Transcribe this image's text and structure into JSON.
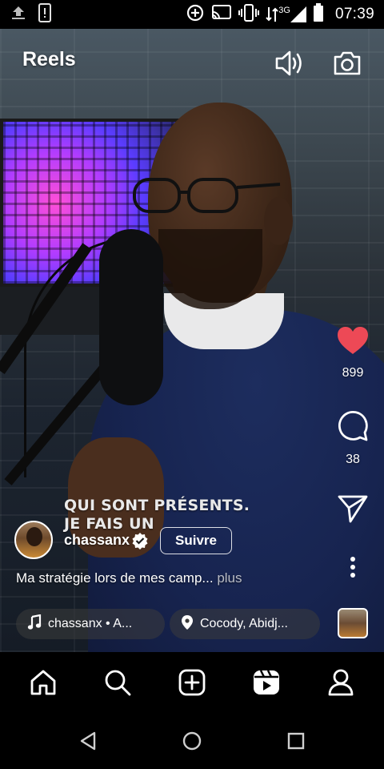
{
  "status_bar": {
    "time": "07:39",
    "network": "3G",
    "icons": [
      "upload-icon",
      "phone-icon",
      "data-saver-icon",
      "cast-icon",
      "vibrate-icon",
      "signal-icon",
      "battery-icon"
    ]
  },
  "header": {
    "title": "Reels",
    "icons": [
      "volume-icon",
      "camera-icon"
    ]
  },
  "video": {
    "caption_lines": [
      "QUI SONT PRÉSENTS.",
      "JE FAIS UN"
    ]
  },
  "actions": {
    "likes": "899",
    "comments": "38",
    "icons": [
      "heart-icon",
      "comment-icon",
      "share-icon",
      "more-icon"
    ],
    "heart_color": "#ED4956"
  },
  "author": {
    "username": "chassanx",
    "follow_label": "Suivre"
  },
  "post": {
    "description": "Ma stratégie lors de mes camp...",
    "more_label": "plus"
  },
  "audio": {
    "label": "chassanx • A...",
    "location": "Cocody, Abidj..."
  },
  "bottom_nav": [
    "home-icon",
    "search-icon",
    "create-icon",
    "reels-icon",
    "profile-icon"
  ],
  "android_nav": [
    "back-icon",
    "home-circle-icon",
    "recents-icon"
  ]
}
